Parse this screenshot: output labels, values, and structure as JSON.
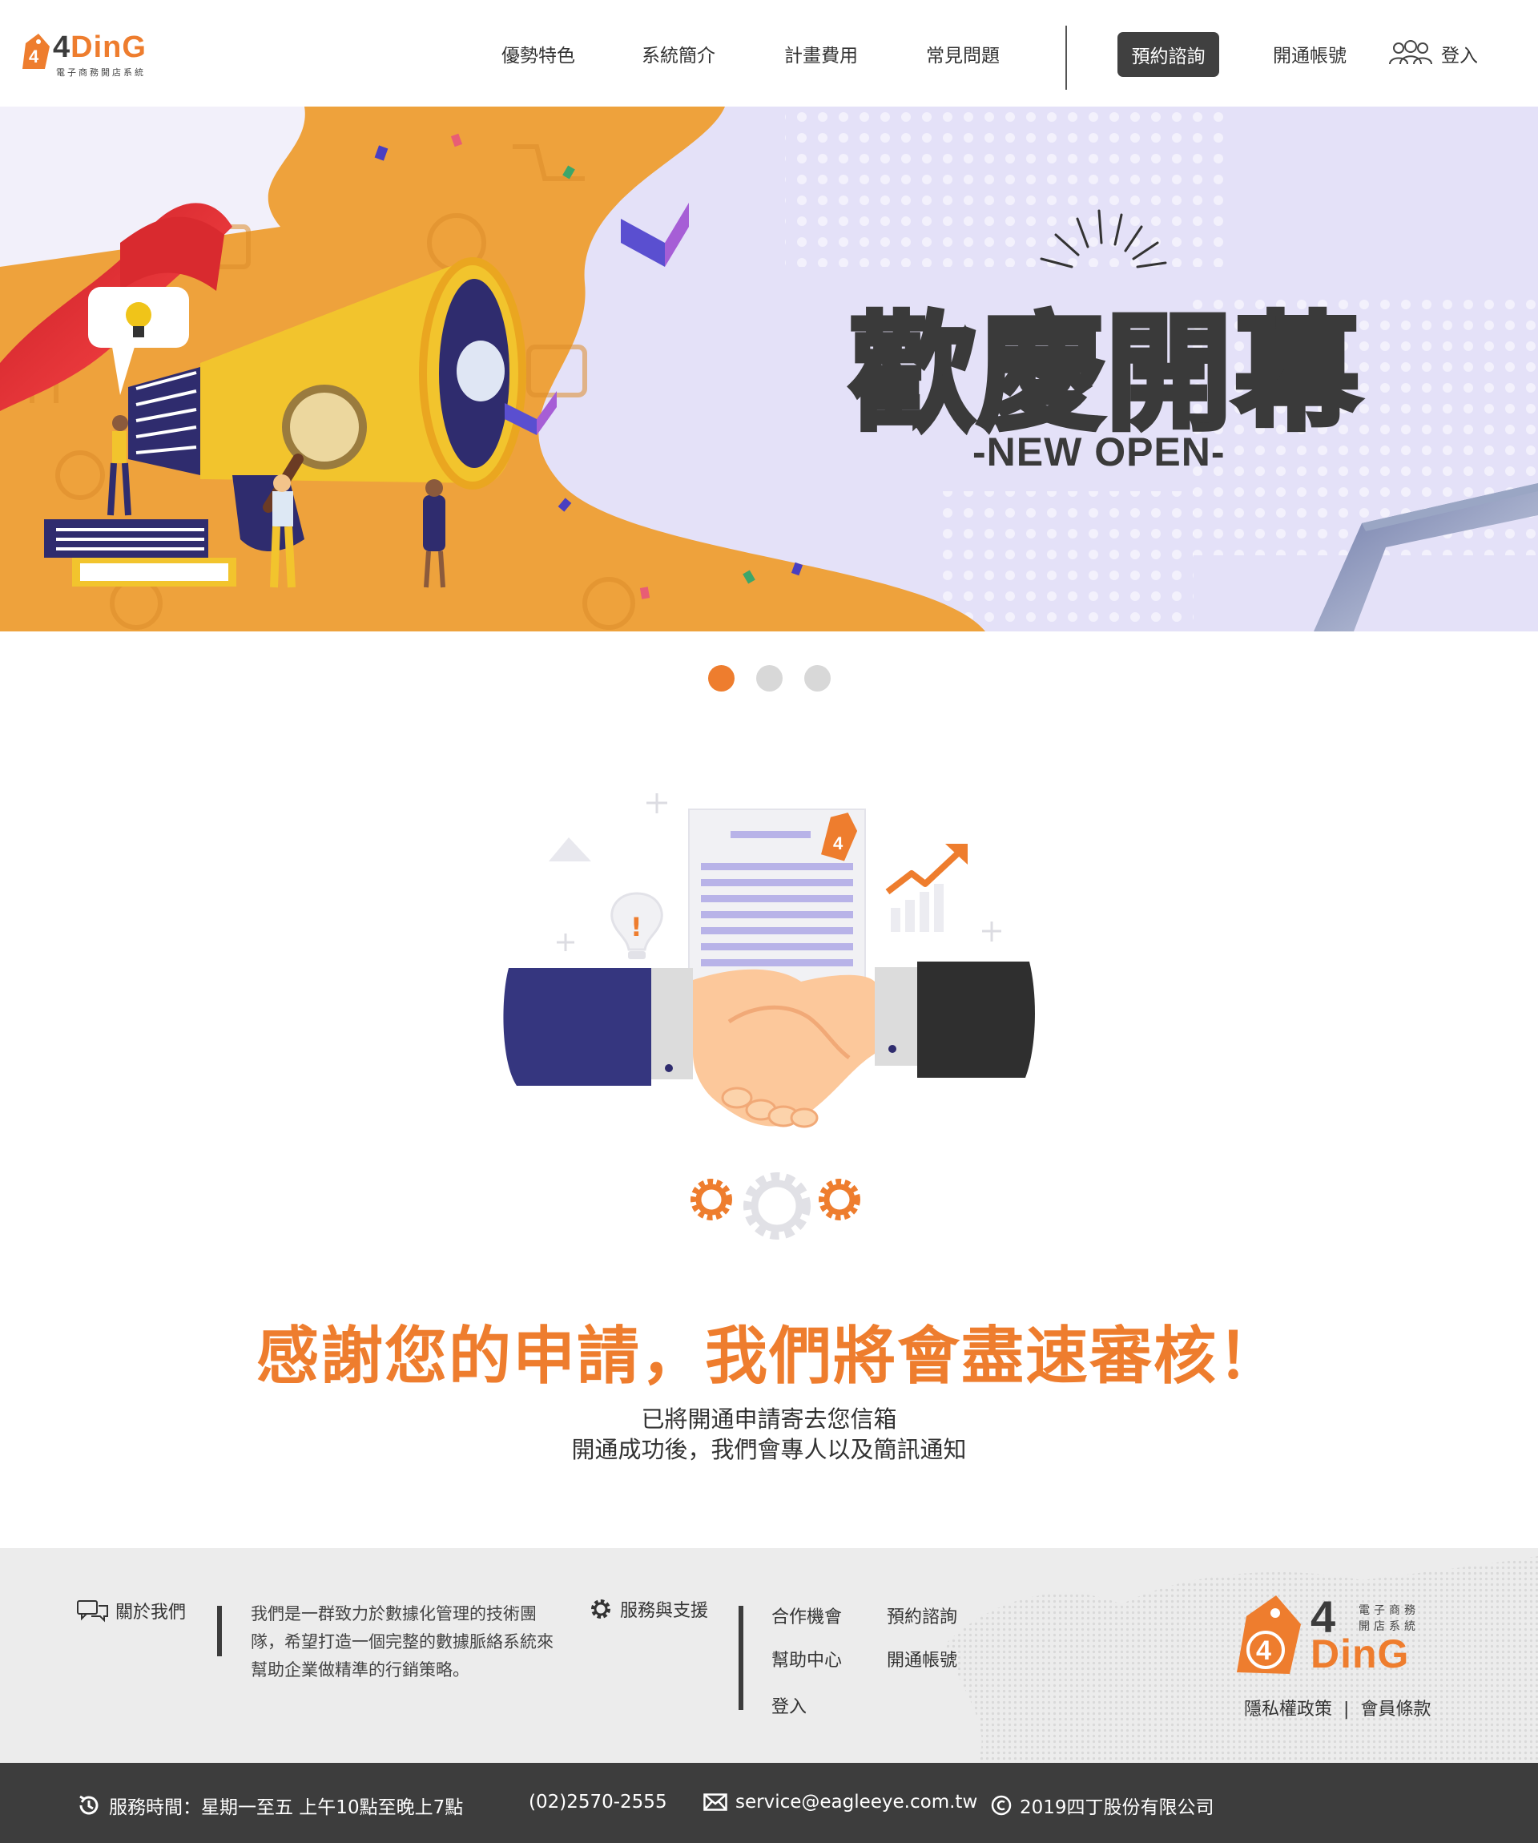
{
  "brand": {
    "logo_word": "DinG",
    "logo_digit": "4",
    "logo_subtitle": "電子商務開店系統",
    "accent_color": "#ee7d2e",
    "dark_color": "#3d3d3d"
  },
  "nav": {
    "items": [
      {
        "label": "優勢特色"
      },
      {
        "label": "系統簡介"
      },
      {
        "label": "計畫費用"
      },
      {
        "label": "常見問題"
      }
    ],
    "consult_button": "預約諮詢",
    "open_account": "開通帳號",
    "login": "登入",
    "login_icon": "users-icon"
  },
  "banner": {
    "title": "歡慶開幕",
    "subtitle": "-NEW OPEN-",
    "slides": 3,
    "active_slide": 1
  },
  "confirmation": {
    "headline": "感謝您的申請，我們將會盡速審核！",
    "line1": "已將開通申請寄去您信箱",
    "line2": "開通成功後，我們會專人以及簡訊通知",
    "illustration_icon": "handshake-icon"
  },
  "footer": {
    "about_label": "關於我們",
    "about_icon": "chat-bubbles-icon",
    "about_text": "我們是一群致力於數據化管理的技術團隊，希望打造一個完整的數據脈絡系統來幫助企業做精準的行銷策略。",
    "support_label": "服務與支援",
    "support_icon": "gear-icon",
    "links": {
      "partner": "合作機會",
      "consult": "預約諮詢",
      "help": "幫助中心",
      "open_account": "開通帳號",
      "login": "登入"
    },
    "logo_digit": "4",
    "logo_word": "DinG",
    "logo_sub1": "電子商務",
    "logo_sub2": "開店系統",
    "privacy": "隱私權政策",
    "terms": "會員條款",
    "legal_separator": "|"
  },
  "bottom_bar": {
    "hours": "服務時間：星期一至五 上午10點至晚上7點",
    "phone": "(02)2570-2555",
    "email": "service@eagleeye.com.tw",
    "copyright": "2019四丁股份有限公司"
  }
}
